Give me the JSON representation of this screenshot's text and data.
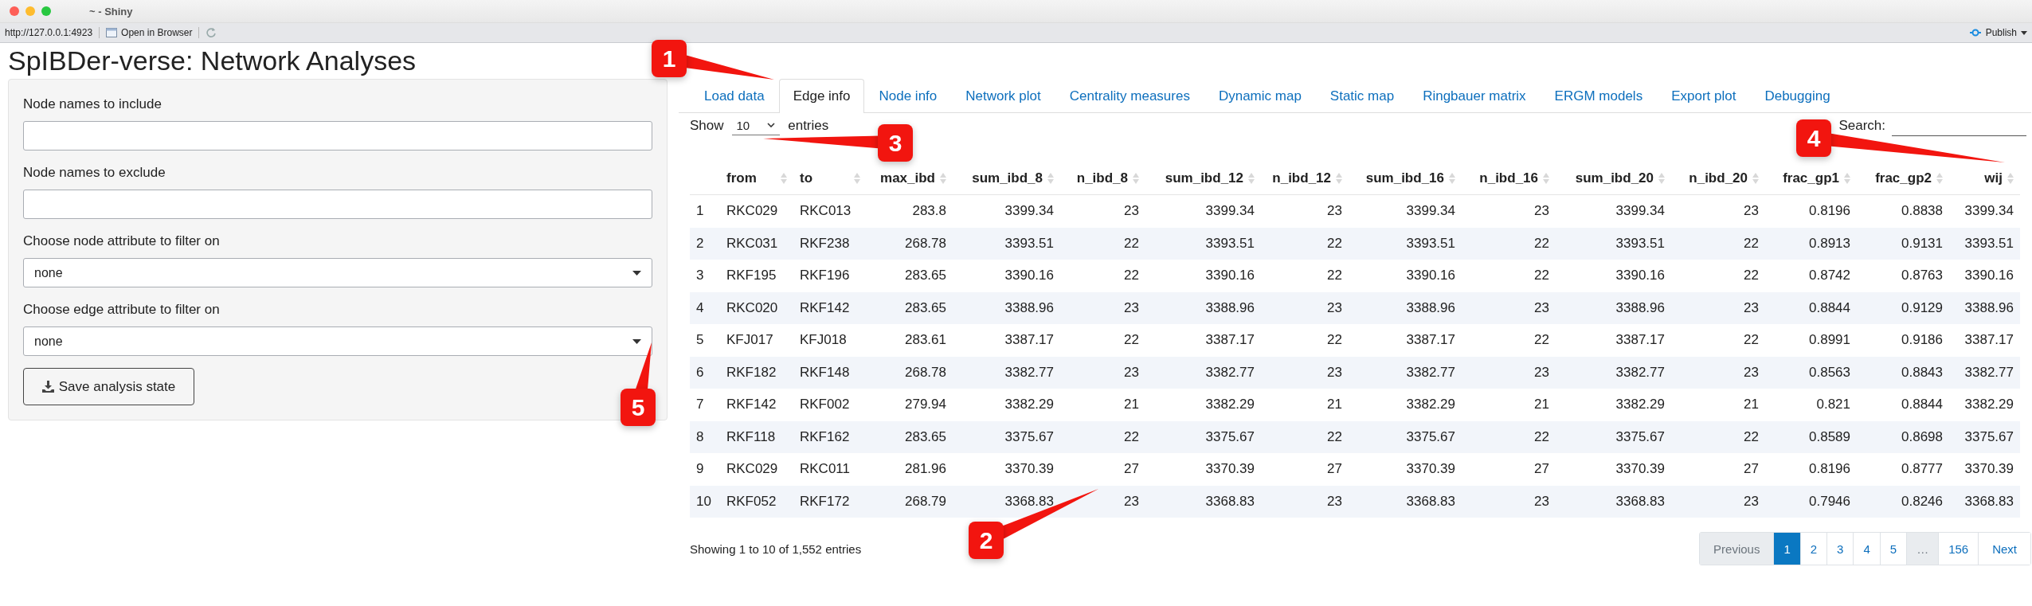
{
  "window": {
    "title": "~ - Shiny"
  },
  "toolbar": {
    "url": "http://127.0.0.1:4923",
    "open_button": "Open in Browser",
    "publish_button": "Publish"
  },
  "app_title": "SpIBDer-verse: Network Analyses",
  "sidebar": {
    "fields": [
      {
        "kind": "text",
        "label": "Node names to include"
      },
      {
        "kind": "text",
        "label": "Node names to exclude"
      },
      {
        "kind": "select",
        "label": "Choose node attribute to filter on",
        "value": "none"
      },
      {
        "kind": "select",
        "label": "Choose edge attribute to filter on",
        "value": "none"
      }
    ],
    "save_button": "Save analysis state"
  },
  "tabs": [
    {
      "label": "Load data",
      "selected": false
    },
    {
      "label": "Edge info",
      "selected": true
    },
    {
      "label": "Node info",
      "selected": false
    },
    {
      "label": "Network plot",
      "selected": false
    },
    {
      "label": "Centrality measures",
      "selected": false
    },
    {
      "label": "Dynamic map",
      "selected": false
    },
    {
      "label": "Static map",
      "selected": false
    },
    {
      "label": "Ringbauer matrix",
      "selected": false
    },
    {
      "label": "ERGM models",
      "selected": false
    },
    {
      "label": "Export plot",
      "selected": false
    },
    {
      "label": "Debugging",
      "selected": false
    }
  ],
  "table": {
    "length_before": "Show",
    "length_value": "10",
    "length_after": "entries",
    "search_label": "Search:",
    "columns": [
      {
        "kind": "index"
      },
      {
        "label": "from",
        "kind": "text"
      },
      {
        "label": "to",
        "kind": "text"
      },
      {
        "label": "max_ibd",
        "kind": "number"
      },
      {
        "label": "sum_ibd_8",
        "kind": "number"
      },
      {
        "label": "n_ibd_8",
        "kind": "number"
      },
      {
        "label": "sum_ibd_12",
        "kind": "number"
      },
      {
        "label": "n_ibd_12",
        "kind": "number"
      },
      {
        "label": "sum_ibd_16",
        "kind": "number"
      },
      {
        "label": "n_ibd_16",
        "kind": "number"
      },
      {
        "label": "sum_ibd_20",
        "kind": "number"
      },
      {
        "label": "n_ibd_20",
        "kind": "number"
      },
      {
        "label": "frac_gp1",
        "kind": "number"
      },
      {
        "label": "frac_gp2",
        "kind": "number"
      },
      {
        "label": "wij",
        "kind": "number"
      }
    ],
    "rows": [
      [
        "1",
        "RKC029",
        "RKC013",
        "283.8",
        "3399.34",
        "23",
        "3399.34",
        "23",
        "3399.34",
        "23",
        "3399.34",
        "23",
        "0.8196",
        "0.8838",
        "3399.34"
      ],
      [
        "2",
        "RKC031",
        "RKF238",
        "268.78",
        "3393.51",
        "22",
        "3393.51",
        "22",
        "3393.51",
        "22",
        "3393.51",
        "22",
        "0.8913",
        "0.9131",
        "3393.51"
      ],
      [
        "3",
        "RKF195",
        "RKF196",
        "283.65",
        "3390.16",
        "22",
        "3390.16",
        "22",
        "3390.16",
        "22",
        "3390.16",
        "22",
        "0.8742",
        "0.8763",
        "3390.16"
      ],
      [
        "4",
        "RKC020",
        "RKF142",
        "283.65",
        "3388.96",
        "23",
        "3388.96",
        "23",
        "3388.96",
        "23",
        "3388.96",
        "23",
        "0.8844",
        "0.9129",
        "3388.96"
      ],
      [
        "5",
        "KFJ017",
        "KFJ018",
        "283.61",
        "3387.17",
        "22",
        "3387.17",
        "22",
        "3387.17",
        "22",
        "3387.17",
        "22",
        "0.8991",
        "0.9186",
        "3387.17"
      ],
      [
        "6",
        "RKF182",
        "RKF148",
        "268.78",
        "3382.77",
        "23",
        "3382.77",
        "23",
        "3382.77",
        "23",
        "3382.77",
        "23",
        "0.8563",
        "0.8843",
        "3382.77"
      ],
      [
        "7",
        "RKF142",
        "RKF002",
        "279.94",
        "3382.29",
        "21",
        "3382.29",
        "21",
        "3382.29",
        "21",
        "3382.29",
        "21",
        "0.821",
        "0.8844",
        "3382.29"
      ],
      [
        "8",
        "RKF118",
        "RKF162",
        "283.65",
        "3375.67",
        "22",
        "3375.67",
        "22",
        "3375.67",
        "22",
        "3375.67",
        "22",
        "0.8589",
        "0.8698",
        "3375.67"
      ],
      [
        "9",
        "RKC029",
        "RKC011",
        "281.96",
        "3370.39",
        "27",
        "3370.39",
        "27",
        "3370.39",
        "27",
        "3370.39",
        "27",
        "0.8196",
        "0.8777",
        "3370.39"
      ],
      [
        "10",
        "RKF052",
        "RKF172",
        "268.79",
        "3368.83",
        "23",
        "3368.83",
        "23",
        "3368.83",
        "23",
        "3368.83",
        "23",
        "0.7946",
        "0.8246",
        "3368.83"
      ]
    ],
    "info": "Showing 1 to 10 of 1,552 entries"
  },
  "pagination": [
    {
      "label": "Previous",
      "kind": "prev",
      "selected": false,
      "disabled": true
    },
    {
      "label": "1",
      "kind": "page",
      "selected": true,
      "disabled": false
    },
    {
      "label": "2",
      "kind": "page",
      "selected": false,
      "disabled": false
    },
    {
      "label": "3",
      "kind": "page",
      "selected": false,
      "disabled": false
    },
    {
      "label": "4",
      "kind": "page",
      "selected": false,
      "disabled": false
    },
    {
      "label": "5",
      "kind": "page",
      "selected": false,
      "disabled": false
    },
    {
      "label": "…",
      "kind": "ellipsis",
      "selected": false,
      "disabled": true
    },
    {
      "label": "156",
      "kind": "page",
      "selected": false,
      "disabled": false
    },
    {
      "label": "Next",
      "kind": "next",
      "selected": false,
      "disabled": false
    }
  ],
  "callouts": [
    {
      "label": "1"
    },
    {
      "label": "2"
    },
    {
      "label": "3"
    },
    {
      "label": "4"
    },
    {
      "label": "5"
    }
  ]
}
